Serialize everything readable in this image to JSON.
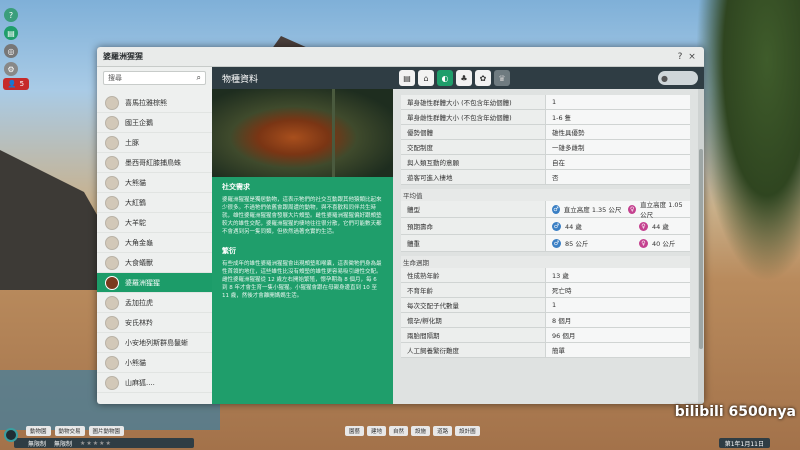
{
  "window": {
    "title": "婆羅洲猩猩",
    "help": "?",
    "close": "×"
  },
  "search": {
    "placeholder": "搜尋"
  },
  "species": [
    {
      "label": "喜馬拉雅棕熊"
    },
    {
      "label": "國王企鵝"
    },
    {
      "label": "土豚"
    },
    {
      "label": "墨西哥紅膝捕鳥蛛"
    },
    {
      "label": "大熊貓"
    },
    {
      "label": "大紅鶴"
    },
    {
      "label": "大羊駝"
    },
    {
      "label": "大角金龜"
    },
    {
      "label": "大食蟻獸"
    },
    {
      "label": "婆羅洲猩猩",
      "selected": true
    },
    {
      "label": "孟加拉虎"
    },
    {
      "label": "安氏林羚"
    },
    {
      "label": "小安地列斯群島鬣蜥"
    },
    {
      "label": "小熊貓"
    },
    {
      "label": "山麻狐...."
    }
  ],
  "info_panel": {
    "header": "物種資料",
    "social": {
      "title": "社交需求",
      "text": "婆羅洲猩猩是獨居動物，這表示牠們的社交互動跟其他猿類比起來少很多。不過牠們依舊會跟周遭的動物，與不喜歡和同伴共生時就，雄性婆羅洲猩猩會發展大片頰墊。雌性婆羅洲猩猩偏好跟頰墊較大的雄性交配，婆羅洲猩猩的棲地往往很分散，它們可能數天都不會遇到另一隻同類，但依然過著充實的生活。"
    },
    "breeding": {
      "title": "繁衍",
      "text": "有些成年的雄性婆羅洲猩猩會出現頰墊和喉囊，這表徵牠們身為最性首領的地位，這些雄性比沒有頰墊的雄性更容易吸引雌性交配。雌性婆羅洲猩猩從 12 歲左右開始繁殖，懷孕期為 8 個月，每 6 到 8 年才會生育一隻小猩猩。小猩猩會跟在母親身邊直到 10 至 11 歲，然後才會離開媽媽生活。"
    }
  },
  "tabs": [
    {
      "icon": "document-icon"
    },
    {
      "icon": "habitat-icon"
    },
    {
      "icon": "food-icon",
      "active": true
    },
    {
      "icon": "enrichment-icon"
    },
    {
      "icon": "paw-icon"
    },
    {
      "icon": "trophy-icon",
      "disabled": true
    }
  ],
  "details": {
    "social_rows": [
      {
        "k": "單身雄性群體大小 (不包含年幼個體)",
        "v": "1"
      },
      {
        "k": "單身雌性群體大小 (不包含年幼個體)",
        "v": "1-6 隻"
      },
      {
        "k": "優勢個體",
        "v": "雄性具優勢"
      },
      {
        "k": "交配制度",
        "v": "一雄多雌制"
      },
      {
        "k": "與人類互動的意願",
        "v": "自在"
      },
      {
        "k": "遊客可進入棲地",
        "v": "否"
      }
    ],
    "average": {
      "title": "平均值",
      "rows": [
        {
          "k": "體型",
          "male": "直立高度 1.35 公尺",
          "female": "直立高度 1.05 公尺"
        },
        {
          "k": "預期壽命",
          "male": "44 歲",
          "female": "44 歲"
        },
        {
          "k": "體重",
          "male": "85 公斤",
          "female": "40 公斤"
        }
      ]
    },
    "lifecycle": {
      "title": "生命週期",
      "rows": [
        {
          "k": "性成熟年齡",
          "v": "13 歲"
        },
        {
          "k": "不育年齡",
          "v": "死亡時"
        },
        {
          "k": "每次交配子代數量",
          "v": "1"
        },
        {
          "k": "懷孕/孵化期",
          "v": "8 個月"
        },
        {
          "k": "兩胎間隔期",
          "v": "96 個月"
        },
        {
          "k": "人工飼養繁衍難度",
          "v": "簡單"
        }
      ]
    }
  },
  "bottom": {
    "buttons": [
      "動物園",
      "動物交易",
      "圖片動物園"
    ],
    "status1": "無限制",
    "status2": "無限制",
    "stars": "★★★★★",
    "tools": [
      "園藝",
      "建地",
      "自然",
      "設施",
      "道路",
      "設計圖"
    ],
    "date": "第1年1月11日",
    "watermark": "bilibili 6500nya"
  },
  "colors": {
    "accent": "#1f9e6b",
    "header": "#2f3d44",
    "male": "#3a7fc4",
    "female": "#c4418f"
  }
}
